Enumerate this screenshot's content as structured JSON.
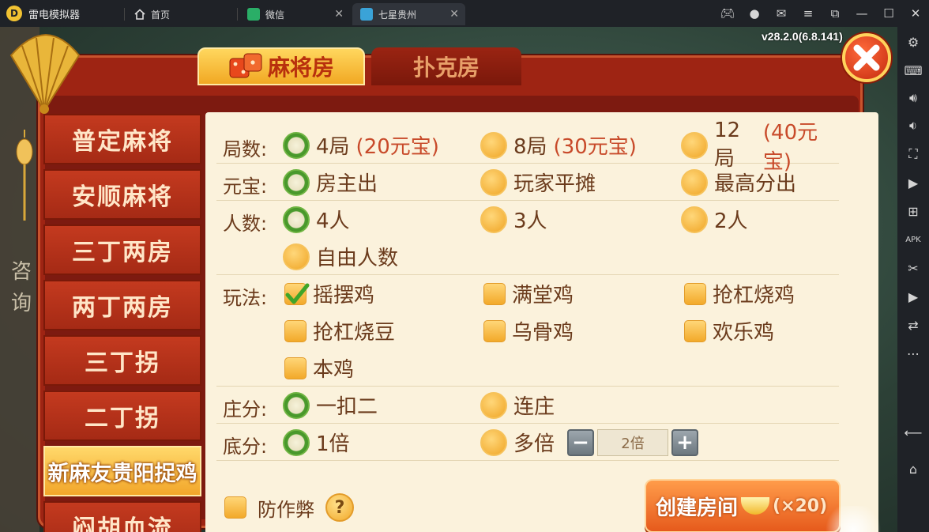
{
  "emulator": {
    "app_name": "雷电模拟器",
    "tabs": [
      {
        "label": "首页"
      },
      {
        "label": "微信"
      },
      {
        "label": "七星贵州"
      }
    ]
  },
  "game": {
    "version": "v28.2.0(6.8.141)",
    "background_text": "咨询",
    "room_tabs": {
      "mahjong": "麻将房",
      "poker": "扑克房"
    },
    "game_menu": [
      "普定麻将",
      "安顺麻将",
      "三丁两房",
      "两丁两房",
      "三丁拐",
      "二丁拐",
      "新麻友贵阳捉鸡",
      "闷胡血流"
    ],
    "active_game_index": 6,
    "options": {
      "rounds": {
        "label": "局数:",
        "choices": [
          {
            "text": "4局",
            "price": "(20元宝)",
            "selected": true
          },
          {
            "text": "8局",
            "price": "(30元宝)",
            "selected": false
          },
          {
            "text": "12局",
            "price": "(40元宝)",
            "selected": false
          }
        ]
      },
      "ingot": {
        "label": "元宝:",
        "choices": [
          {
            "text": "房主出",
            "selected": true
          },
          {
            "text": "玩家平摊",
            "selected": false
          },
          {
            "text": "最高分出",
            "selected": false
          }
        ]
      },
      "players": {
        "label": "人数:",
        "choices": [
          {
            "text": "4人",
            "selected": true
          },
          {
            "text": "3人",
            "selected": false
          },
          {
            "text": "2人",
            "selected": false
          },
          {
            "text": "自由人数",
            "selected": false
          }
        ]
      },
      "rules": {
        "label": "玩法:",
        "choices": [
          {
            "text": "摇摆鸡",
            "checked": true
          },
          {
            "text": "满堂鸡",
            "checked": false
          },
          {
            "text": "抢杠烧鸡",
            "checked": false
          },
          {
            "text": "抢杠烧豆",
            "checked": false
          },
          {
            "text": "乌骨鸡",
            "checked": false
          },
          {
            "text": "欢乐鸡",
            "checked": false
          },
          {
            "text": "本鸡",
            "checked": false
          }
        ]
      },
      "dealer_score": {
        "label": "庄分:",
        "choices": [
          {
            "text": "一扣二",
            "selected": true
          },
          {
            "text": "连庄",
            "selected": false
          }
        ]
      },
      "base_score": {
        "label": "底分:",
        "choices": [
          {
            "text": "1倍",
            "selected": true
          },
          {
            "text": "多倍",
            "selected": false
          }
        ],
        "multiplier_value": "2倍"
      }
    },
    "anti_cheat_label": "防作弊",
    "create_button": {
      "label": "创建房间",
      "cost": "(×20)"
    },
    "colors": {
      "accent_red": "#9e2413",
      "gold": "#f2a62a",
      "panel_bg": "#fbf2dc",
      "text_brown": "#6b3b1c",
      "price_red": "#c84a2a",
      "selected_green": "#3e8a23"
    }
  },
  "sidebar_icons": [
    "settings-icon",
    "keyboard-icon",
    "volume-up-icon",
    "volume-down-icon",
    "screenshot-icon",
    "record-icon",
    "add-window-icon",
    "apk-icon",
    "scissors-icon",
    "play-icon",
    "sync-icon",
    "more-icon",
    "back-icon",
    "home-icon"
  ]
}
